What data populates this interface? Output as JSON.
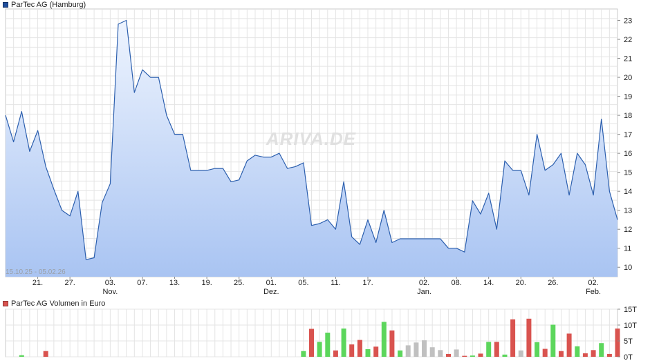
{
  "legend": {
    "price_label": "ParTec AG (Hamburg)",
    "price_color": "#1f4e9c",
    "volume_label": "ParTec AG Volumen in Euro",
    "volume_color": "#d9534f"
  },
  "watermark": "ARIVA.DE",
  "chart_data": [
    {
      "type": "area",
      "series": [
        {
          "name": "ParTec AG (Hamburg)",
          "values": [
            18.0,
            16.6,
            18.2,
            16.1,
            17.2,
            15.3,
            14.1,
            13.0,
            12.7,
            14.0,
            10.4,
            10.5,
            13.4,
            14.4,
            22.8,
            23.0,
            19.2,
            20.4,
            20.0,
            20.0,
            18.0,
            17.0,
            17.0,
            15.1,
            15.1,
            15.1,
            15.2,
            15.2,
            14.5,
            14.6,
            15.6,
            15.9,
            15.8,
            15.8,
            16.0,
            15.2,
            15.3,
            15.5,
            12.2,
            12.3,
            12.5,
            12.0,
            14.5,
            11.6,
            11.2,
            12.5,
            11.3,
            13.0,
            11.3,
            11.5,
            11.5,
            11.5,
            11.5,
            11.5,
            11.5,
            11.0,
            11.0,
            10.8,
            13.5,
            12.8,
            13.9,
            12.0,
            15.6,
            15.1,
            15.1,
            13.8,
            17.0,
            15.1,
            15.4,
            16.0,
            13.8,
            16.0,
            15.4,
            13.8,
            17.8,
            14.0,
            12.5
          ]
        }
      ],
      "range_label": "15.10.25 - 05.02.26",
      "y_ticks": [
        10,
        11,
        12,
        13,
        14,
        15,
        16,
        17,
        18,
        19,
        20,
        21,
        22,
        23
      ],
      "x_ticks": [
        {
          "index": 4,
          "day": "21.",
          "month": ""
        },
        {
          "index": 8,
          "day": "27.",
          "month": ""
        },
        {
          "index": 13,
          "day": "03.",
          "month": "Nov."
        },
        {
          "index": 17,
          "day": "07.",
          "month": ""
        },
        {
          "index": 21,
          "day": "13.",
          "month": ""
        },
        {
          "index": 25,
          "day": "19.",
          "month": ""
        },
        {
          "index": 29,
          "day": "25.",
          "month": ""
        },
        {
          "index": 33,
          "day": "01.",
          "month": "Dez."
        },
        {
          "index": 37,
          "day": "05.",
          "month": ""
        },
        {
          "index": 41,
          "day": "11.",
          "month": ""
        },
        {
          "index": 45,
          "day": "17.",
          "month": ""
        },
        {
          "index": 52,
          "day": "02.",
          "month": "Jan."
        },
        {
          "index": 56,
          "day": "08.",
          "month": ""
        },
        {
          "index": 60,
          "day": "14.",
          "month": ""
        },
        {
          "index": 64,
          "day": "20.",
          "month": ""
        },
        {
          "index": 68,
          "day": "26.",
          "month": ""
        },
        {
          "index": 73,
          "day": "02.",
          "month": "Feb."
        }
      ],
      "line_color": "#2c5fae",
      "fill_top_color": "#eef4fe",
      "fill_bottom_color": "#a9c4f2",
      "grid": true
    },
    {
      "type": "bar",
      "series": [
        {
          "name": "ParTec AG Volumen in Euro",
          "values": [
            0,
            0,
            0.5,
            0,
            0,
            1.8,
            0,
            0,
            0,
            0,
            0,
            0,
            0,
            0,
            0,
            0,
            0,
            0,
            0,
            0,
            0,
            0,
            0,
            0,
            0,
            0,
            0,
            0,
            0,
            0,
            0,
            0,
            0,
            0,
            0,
            0,
            0,
            1.8,
            8.8,
            4.7,
            7.6,
            2.0,
            8.9,
            3.9,
            5.3,
            2.4,
            3.2,
            11.0,
            8.3,
            2.0,
            3.6,
            4.5,
            5.2,
            3.0,
            2.1,
            0.9,
            2.3,
            0.3,
            0.4,
            1.0,
            4.7,
            4.7,
            0.7,
            11.8,
            2.0,
            12.0,
            4.6,
            2.5,
            10.1,
            1.8,
            7.3,
            3.3,
            1.1,
            2.1,
            4.3,
            0.9,
            8.9
          ]
        }
      ],
      "colors": [
        "#d9534f",
        "#d9534f",
        "#5cd65c",
        "#d9534f",
        "#d9534f",
        "#d9534f",
        "#d9534f",
        "#d9534f",
        "#d9534f",
        "#d9534f",
        "#d9534f",
        "#d9534f",
        "#d9534f",
        "#d9534f",
        "#d9534f",
        "#d9534f",
        "#d9534f",
        "#d9534f",
        "#d9534f",
        "#d9534f",
        "#d9534f",
        "#d9534f",
        "#d9534f",
        "#d9534f",
        "#d9534f",
        "#d9534f",
        "#d9534f",
        "#d9534f",
        "#d9534f",
        "#d9534f",
        "#d9534f",
        "#d9534f",
        "#d9534f",
        "#d9534f",
        "#d9534f",
        "#d9534f",
        "#d9534f",
        "#5cd65c",
        "#d9534f",
        "#5cd65c",
        "#5cd65c",
        "#d9534f",
        "#5cd65c",
        "#d9534f",
        "#d9534f",
        "#5cd65c",
        "#d9534f",
        "#5cd65c",
        "#d9534f",
        "#5cd65c",
        "#c0c0c0",
        "#c0c0c0",
        "#c0c0c0",
        "#c0c0c0",
        "#c0c0c0",
        "#d9534f",
        "#c0c0c0",
        "#d9534f",
        "#5cd65c",
        "#d9534f",
        "#5cd65c",
        "#d9534f",
        "#5cd65c",
        "#d9534f",
        "#c0c0c0",
        "#d9534f",
        "#5cd65c",
        "#d9534f",
        "#5cd65c",
        "#d9534f",
        "#d9534f",
        "#5cd65c",
        "#d9534f",
        "#d9534f",
        "#5cd65c",
        "#d9534f",
        "#d9534f"
      ],
      "y_ticks": [
        {
          "value": 0,
          "label": "0T"
        },
        {
          "value": 5,
          "label": "5T"
        },
        {
          "value": 10,
          "label": "10T"
        },
        {
          "value": 15,
          "label": "15T"
        }
      ],
      "grid": true
    }
  ]
}
